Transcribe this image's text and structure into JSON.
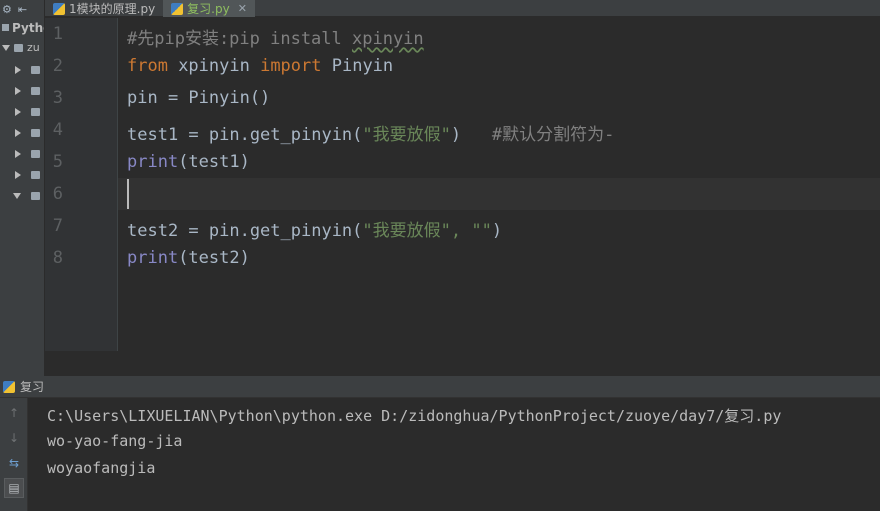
{
  "project": {
    "root_label": "Pytho",
    "sub_label": "zu",
    "toolbar_gear": "⚙",
    "toolbar_collapse": "⇤"
  },
  "tabs": [
    {
      "label": "1模块的原理.py",
      "active": false
    },
    {
      "label": "复习.py",
      "active": true,
      "close": "✕"
    }
  ],
  "editor": {
    "line_numbers": [
      "1",
      "2",
      "3",
      "4",
      "5",
      "6",
      "7",
      "8"
    ],
    "lines": [
      {
        "segments": [
          {
            "t": "#先pip安装:pip install ",
            "c": "cm"
          },
          {
            "t": "xpinyin",
            "c": "cm wavy"
          }
        ]
      },
      {
        "segments": [
          {
            "t": "from",
            "c": "kw"
          },
          {
            "t": " xpinyin ",
            "c": ""
          },
          {
            "t": "import",
            "c": "kw"
          },
          {
            "t": " Pinyin",
            "c": ""
          }
        ]
      },
      {
        "segments": [
          {
            "t": "pin = Pinyin()",
            "c": ""
          }
        ]
      },
      {
        "segments": [
          {
            "t": "test1 = pin.get_pinyin(",
            "c": ""
          },
          {
            "t": "\"我要放假\"",
            "c": "str"
          },
          {
            "t": ")   ",
            "c": ""
          },
          {
            "t": "#默认分割符为-",
            "c": "cm"
          }
        ]
      },
      {
        "segments": [
          {
            "t": "print",
            "c": "bi"
          },
          {
            "t": "(test1)",
            "c": ""
          }
        ]
      },
      {
        "segments": []
      },
      {
        "segments": [
          {
            "t": "test2 = pin.get_pinyin(",
            "c": ""
          },
          {
            "t": "\"我要放假\", \"\"",
            "c": "str"
          },
          {
            "t": ")",
            "c": ""
          }
        ]
      },
      {
        "segments": [
          {
            "t": "print",
            "c": "bi"
          },
          {
            "t": "(test2)",
            "c": ""
          }
        ]
      }
    ],
    "caret_line": 6
  },
  "run_panel": {
    "title": "复习",
    "output": [
      "C:\\Users\\LIXUELIAN\\Python\\python.exe D:/zidonghua/PythonProject/zuoye/day7/复习.py",
      "wo-yao-fang-jia",
      "woyaofangjia"
    ]
  },
  "colors": {
    "keyword": "#cc7832",
    "builtin": "#8888c6",
    "string": "#6a8759",
    "comment": "#808080",
    "text": "#a9b7c6",
    "background": "#2b2b2b"
  }
}
